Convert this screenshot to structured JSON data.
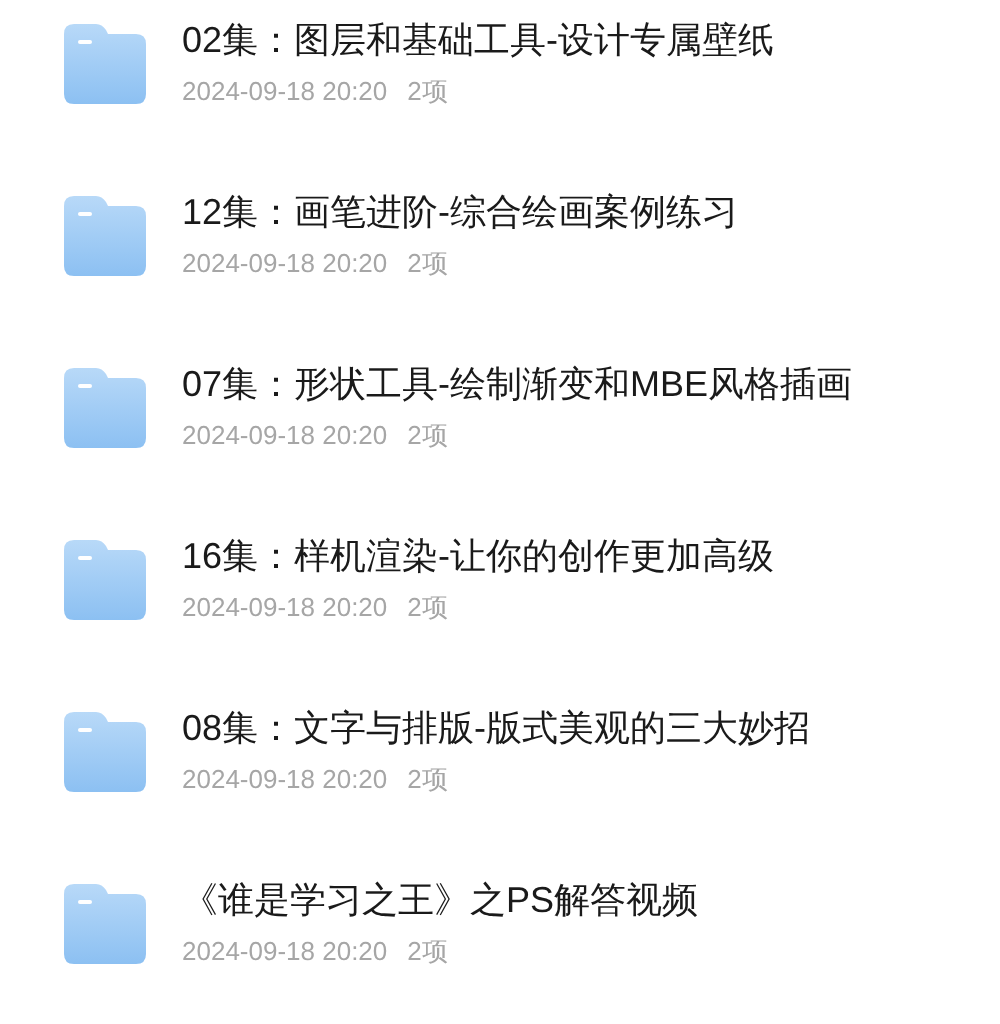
{
  "folders": [
    {
      "title": "02集：图层和基础工具-设计专属壁纸",
      "date": "2024-09-18 20:20",
      "count": "2项"
    },
    {
      "title": "12集：画笔进阶-综合绘画案例练习",
      "date": "2024-09-18 20:20",
      "count": "2项"
    },
    {
      "title": "07集：形状工具-绘制渐变和MBE风格插画",
      "date": "2024-09-18 20:20",
      "count": "2项"
    },
    {
      "title": "16集：样机渲染-让你的创作更加高级",
      "date": "2024-09-18 20:20",
      "count": "2项"
    },
    {
      "title": "08集：文字与排版-版式美观的三大妙招",
      "date": "2024-09-18 20:20",
      "count": "2项"
    },
    {
      "title": "《谁是学习之王》之PS解答视频",
      "date": "2024-09-18 20:20",
      "count": "2项"
    }
  ]
}
